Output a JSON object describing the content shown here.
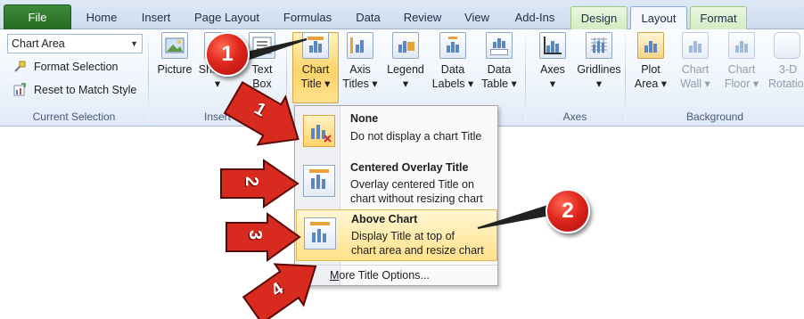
{
  "tabs": [
    {
      "label": "File",
      "kind": "file",
      "left": 0
    },
    {
      "label": "Home"
    },
    {
      "label": "Insert"
    },
    {
      "label": "Page Layout"
    },
    {
      "label": "Formulas"
    },
    {
      "label": "Data"
    },
    {
      "label": "Review"
    },
    {
      "label": "View"
    },
    {
      "label": "Add-Ins"
    },
    {
      "label": "Design"
    },
    {
      "label": "Layout"
    },
    {
      "label": "Format"
    }
  ],
  "current_selection": {
    "combo_value": "Chart Area",
    "format_selection": "Format Selection",
    "reset_to_match_style": "Reset to Match Style",
    "group_label": "Current Selection"
  },
  "insert_group": {
    "picture": "Picture",
    "shapes": "Shapes",
    "shapes_caret": "▾",
    "text_box_1": "Text",
    "text_box_2": "Box",
    "group_label": "Insert"
  },
  "labels_group": {
    "chart_title_1": "Chart",
    "chart_title_2": "Title ▾",
    "axis_titles_1": "Axis",
    "axis_titles_2": "Titles ▾",
    "legend_1": "Legend",
    "legend_2": "▾",
    "data_labels_1": "Data",
    "data_labels_2": "Labels ▾",
    "data_table_1": "Data",
    "data_table_2": "Table ▾"
  },
  "axes_group": {
    "axes_1": "Axes",
    "axes_2": "▾",
    "gridlines_1": "Gridlines",
    "gridlines_2": "▾",
    "group_label": "Axes"
  },
  "background_group": {
    "plot_area_1": "Plot",
    "plot_area_2": "Area ▾",
    "chart_wall_1": "Chart",
    "chart_wall_2": "Wall ▾",
    "chart_floor_1": "Chart",
    "chart_floor_2": "Floor ▾",
    "rotation_1": "3-D",
    "rotation_2": "Rotation",
    "group_label": "Background"
  },
  "menu": {
    "none_title": "None",
    "none_desc": "Do not display a chart Title",
    "overlay_title": "Centered Overlay Title",
    "overlay_desc_1": "Overlay centered Title on",
    "overlay_desc_2": "chart without resizing chart",
    "above_title": "Above Chart",
    "above_desc_1": "Display Title at top of",
    "above_desc_2": "chart area and resize chart",
    "more_underlined": "M",
    "more_rest": "ore Title Options..."
  },
  "annotations": {
    "badge_1": "1",
    "badge_2": "2",
    "arrow_1": "1",
    "arrow_2": "2",
    "arrow_3": "3",
    "arrow_4": "4"
  },
  "colors": {
    "badge_red": "#e0261d",
    "highlight_gold": "#ffd46a",
    "file_tab_green": "#2f7a2c"
  }
}
